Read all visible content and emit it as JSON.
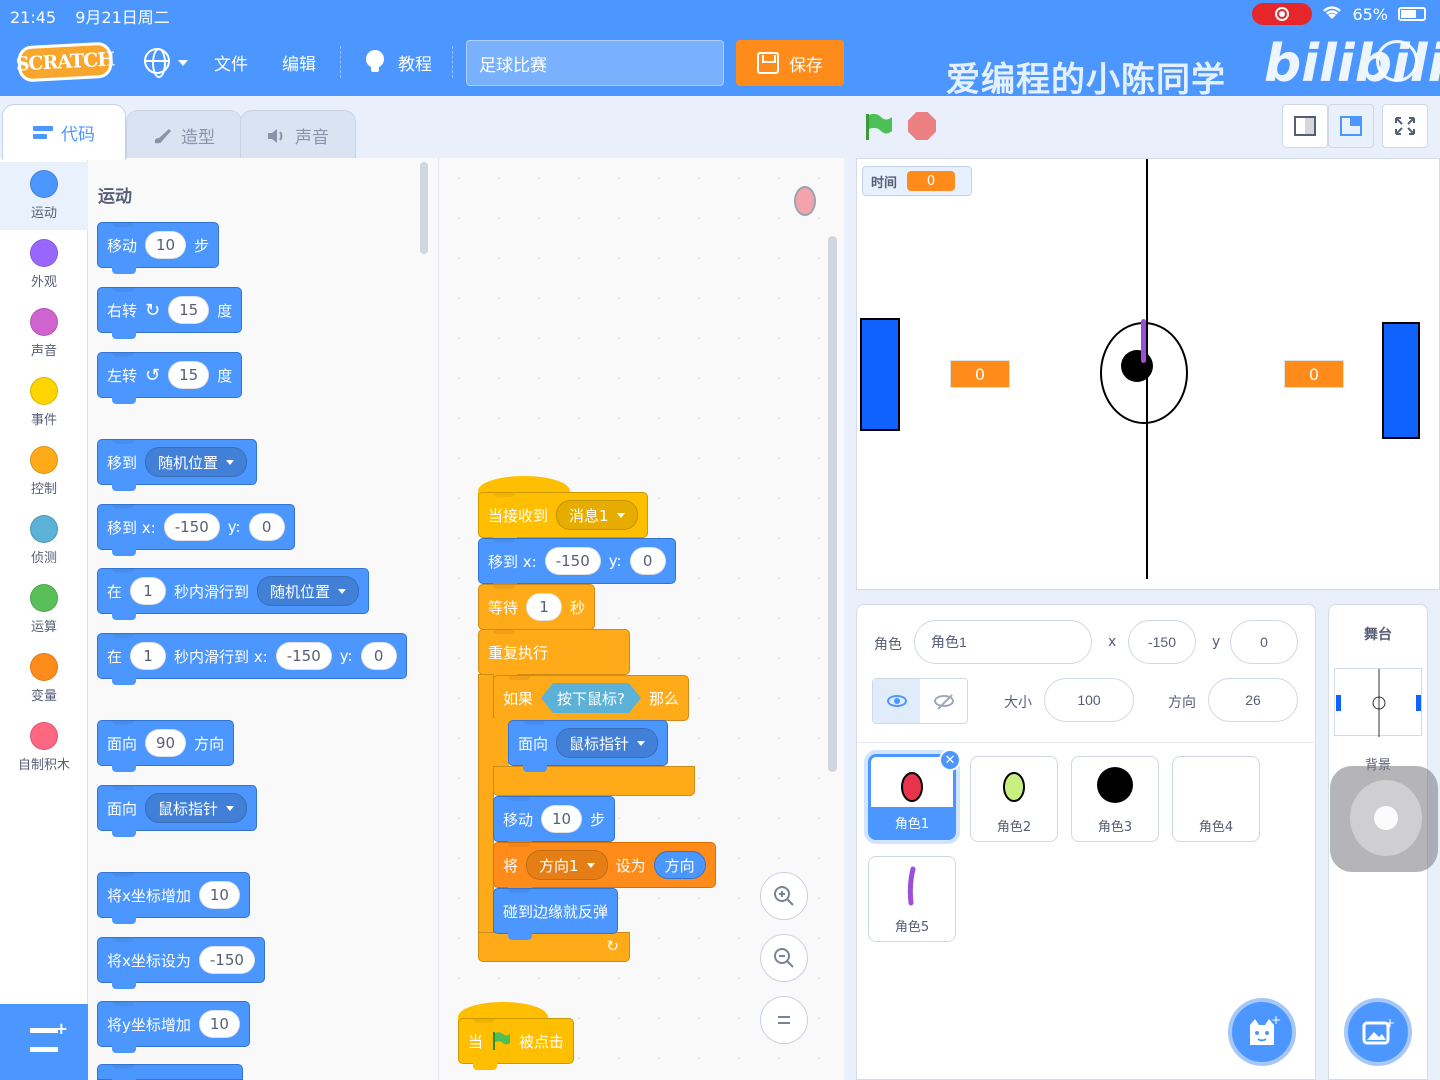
{
  "status_bar": {
    "time": "21:45",
    "date": "9月21日周二",
    "battery": "65%"
  },
  "menu": {
    "logo": "SCRATCH",
    "file": "文件",
    "edit": "编辑",
    "tutorials": "教程",
    "project_title": "足球比赛",
    "save": "保存"
  },
  "watermark": {
    "text": "爱编程的小陈同学",
    "logo": "bilibili"
  },
  "tabs": [
    {
      "label": "代码",
      "active": true
    },
    {
      "label": "造型",
      "active": false
    },
    {
      "label": "声音",
      "active": false
    }
  ],
  "categories": [
    {
      "label": "运动",
      "color": "#4c97ff"
    },
    {
      "label": "外观",
      "color": "#9966ff"
    },
    {
      "label": "声音",
      "color": "#cf63cf"
    },
    {
      "label": "事件",
      "color": "#ffd500"
    },
    {
      "label": "控制",
      "color": "#ffab19"
    },
    {
      "label": "侦测",
      "color": "#5cb1d6"
    },
    {
      "label": "运算",
      "color": "#59c059"
    },
    {
      "label": "变量",
      "color": "#ff8c1a"
    },
    {
      "label": "自制积木",
      "color": "#ff6680"
    }
  ],
  "palette": {
    "title": "运动",
    "move": {
      "a": "移动",
      "n": "10",
      "b": "步"
    },
    "turn_right": {
      "a": "右转",
      "n": "15",
      "b": "度"
    },
    "turn_left": {
      "a": "左转",
      "n": "15",
      "b": "度"
    },
    "goto": {
      "a": "移到",
      "menu": "随机位置"
    },
    "goto_xy": {
      "a": "移到 x:",
      "x": "-150",
      "b": "y:",
      "y": "0"
    },
    "glide": {
      "a": "在",
      "n": "1",
      "b": "秒内滑行到",
      "menu": "随机位置"
    },
    "glide_xy": {
      "a": "在",
      "n": "1",
      "b": "秒内滑行到 x:",
      "x": "-150",
      "c": "y:",
      "y": "0"
    },
    "point": {
      "a": "面向",
      "n": "90",
      "b": "方向"
    },
    "point_towards": {
      "a": "面向",
      "menu": "鼠标指针"
    },
    "change_x": {
      "a": "将x坐标增加",
      "n": "10"
    },
    "set_x": {
      "a": "将x坐标设为",
      "n": "-150"
    },
    "change_y": {
      "a": "将y坐标增加",
      "n": "10"
    }
  },
  "script": {
    "when_receive": {
      "a": "当接收到",
      "menu": "消息1"
    },
    "goto_xy": {
      "a": "移到 x:",
      "x": "-150",
      "b": "y:",
      "y": "0"
    },
    "wait": {
      "a": "等待",
      "n": "1",
      "b": "秒"
    },
    "forever": "重复执行",
    "if": {
      "a": "如果",
      "cond": "按下鼠标?",
      "b": "那么"
    },
    "point_towards": {
      "a": "面向",
      "menu": "鼠标指针"
    },
    "move": {
      "a": "移动",
      "n": "10",
      "b": "步"
    },
    "set_var": {
      "a": "将",
      "menu": "方向1",
      "b": "设为",
      "val": "方向"
    },
    "bounce": "碰到边缘就反弹",
    "when_flag": {
      "a": "当",
      "b": "被点击"
    }
  },
  "stage": {
    "monitor_label": "时间",
    "monitor_value": "0",
    "score_left": "0",
    "score_right": "0"
  },
  "sprite_info": {
    "sprite_label": "角色",
    "sprite_name": "角色1",
    "x_label": "x",
    "x": "-150",
    "y_label": "y",
    "y": "0",
    "size_label": "大小",
    "size": "100",
    "direction_label": "方向",
    "direction": "26"
  },
  "sprites": [
    {
      "name": "角色1",
      "selected": true
    },
    {
      "name": "角色2",
      "selected": false
    },
    {
      "name": "角色3",
      "selected": false
    },
    {
      "name": "角色4",
      "selected": false
    },
    {
      "name": "角色5",
      "selected": false
    }
  ],
  "stage_panel": {
    "title": "舞台",
    "backdrop": "背景"
  },
  "colors": {
    "motion": "#4c97ff",
    "events": "#ffbf00",
    "control": "#ffab19",
    "variables": "#ff8c1a",
    "sensing": "#5cb1d6"
  }
}
